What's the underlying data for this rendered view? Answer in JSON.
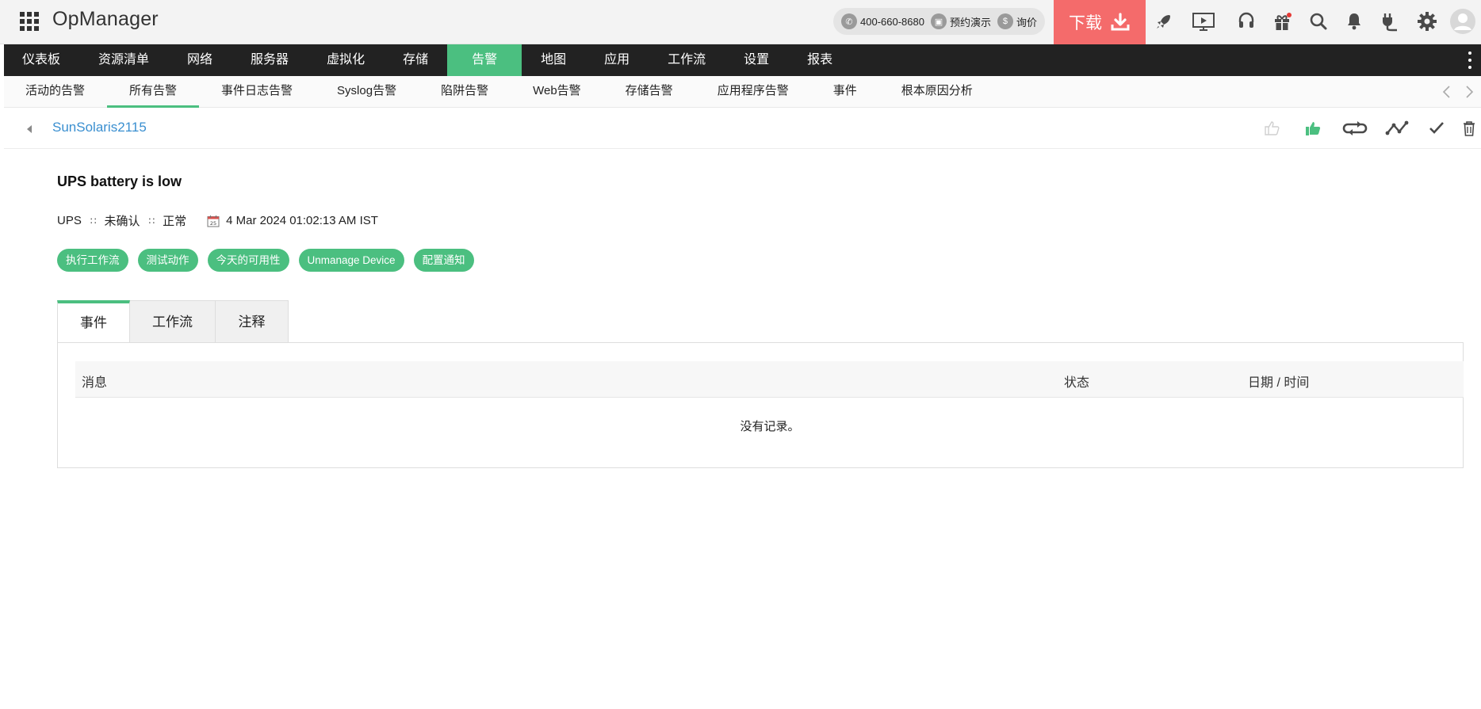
{
  "header": {
    "app_title": "OpManager",
    "phone": "400-660-8680",
    "demo_label": "预约演示",
    "quote_label": "询价",
    "download_label": "下载",
    "icons": [
      "rocket-icon",
      "presentation-icon",
      "headset-icon",
      "gift-icon",
      "search-icon",
      "bell-icon",
      "plug-icon",
      "gear-icon",
      "avatar-icon"
    ]
  },
  "mainnav": {
    "items": [
      {
        "label": "仪表板"
      },
      {
        "label": "资源清单"
      },
      {
        "label": "网络"
      },
      {
        "label": "服务器"
      },
      {
        "label": "虚拟化"
      },
      {
        "label": "存储"
      },
      {
        "label": "告警",
        "active": true
      },
      {
        "label": "地图"
      },
      {
        "label": "应用"
      },
      {
        "label": "工作流"
      },
      {
        "label": "设置"
      },
      {
        "label": "报表"
      }
    ]
  },
  "subnav": {
    "items": [
      {
        "label": "活动的告警"
      },
      {
        "label": "所有告警",
        "active": true
      },
      {
        "label": "事件日志告警"
      },
      {
        "label": "Syslog告警"
      },
      {
        "label": "陷阱告警"
      },
      {
        "label": "Web告警"
      },
      {
        "label": "存储告警"
      },
      {
        "label": "应用程序告警"
      },
      {
        "label": "事件"
      },
      {
        "label": "根本原因分析"
      }
    ]
  },
  "device": {
    "name": "SunSolaris2115",
    "action_icons": [
      "thumbs-up-outline-icon",
      "thumbs-up-filled-icon",
      "repeat-icon",
      "line-graph-icon",
      "check-icon",
      "trash-icon"
    ]
  },
  "alarm": {
    "title": "UPS battery is low",
    "category": "UPS",
    "ack_state": "未确认",
    "severity": "正常",
    "date_icon_text": "25",
    "timestamp": "4 Mar 2024 01:02:13 AM IST",
    "actions": [
      "执行工作流",
      "测试动作",
      "今天的可用性",
      "Unmanage Device",
      "配置通知"
    ]
  },
  "tabs": {
    "items": [
      {
        "label": "事件",
        "active": true
      },
      {
        "label": "工作流"
      },
      {
        "label": "注释"
      }
    ]
  },
  "table": {
    "headers": [
      "消息",
      "状态",
      "日期 / 时间"
    ],
    "empty_text": "没有记录。"
  },
  "colors": {
    "accent_green": "#4bbf80",
    "download_red": "#f46b6b",
    "nav_dark": "#222222",
    "link_blue": "#3a8fd0"
  }
}
